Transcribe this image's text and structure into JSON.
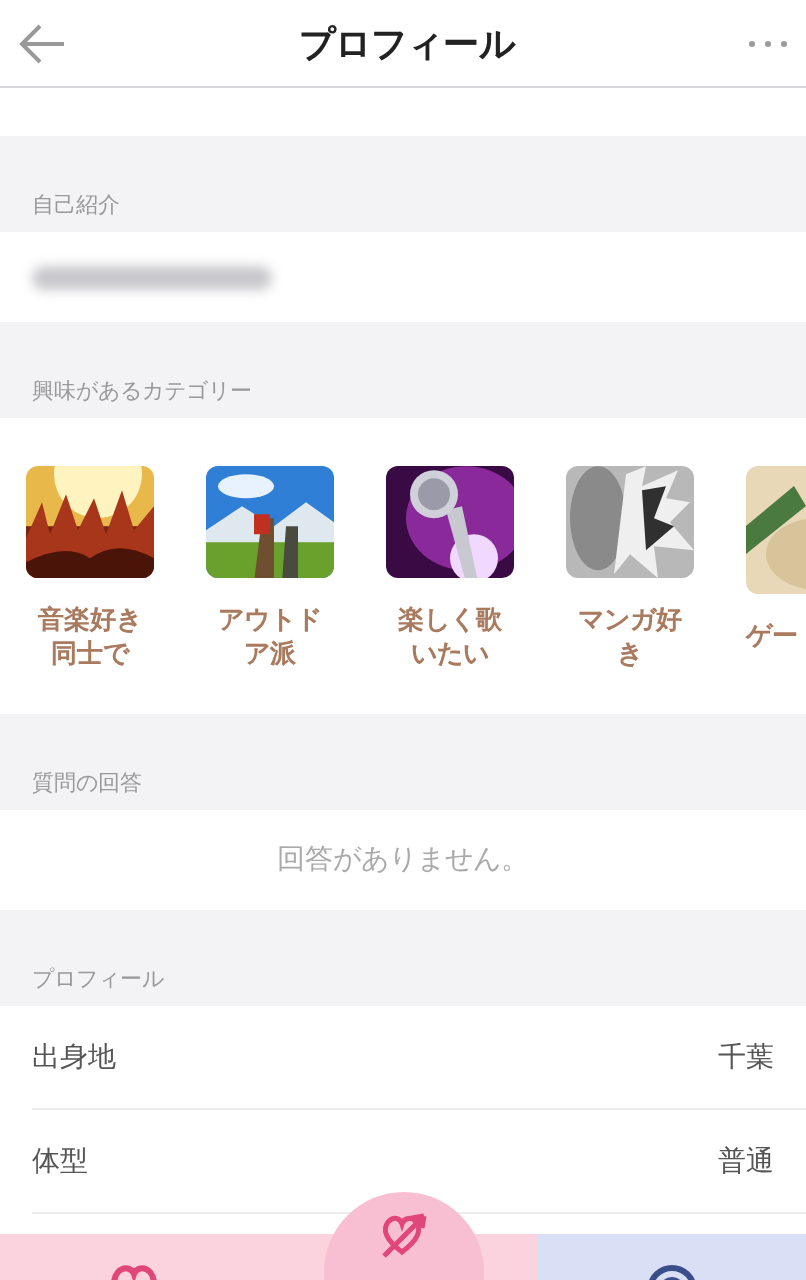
{
  "header": {
    "title": "プロフィール"
  },
  "self_intro": {
    "label": "自己紹介"
  },
  "categories": {
    "label": "興味があるカテゴリー",
    "items": [
      {
        "label": "音楽好き同士で",
        "kind": "concert"
      },
      {
        "label": "アウトドア派",
        "kind": "hiking"
      },
      {
        "label": "楽しく歌いたい",
        "kind": "microphone"
      },
      {
        "label": "マンガ好き",
        "kind": "manga"
      },
      {
        "label": "ゲー",
        "kind": "food"
      }
    ]
  },
  "answers": {
    "label": "質問の回答",
    "empty_text": "回答がありません。"
  },
  "profile": {
    "label": "プロフィール",
    "rows": [
      {
        "key": "出身地",
        "value": "千葉"
      },
      {
        "key": "体型",
        "value": "普通"
      }
    ]
  },
  "tab_bar": {
    "items": [
      {
        "kind": "heart",
        "selected": false
      },
      {
        "kind": "cupid",
        "selected": true
      },
      {
        "kind": "target",
        "selected": false
      }
    ]
  }
}
